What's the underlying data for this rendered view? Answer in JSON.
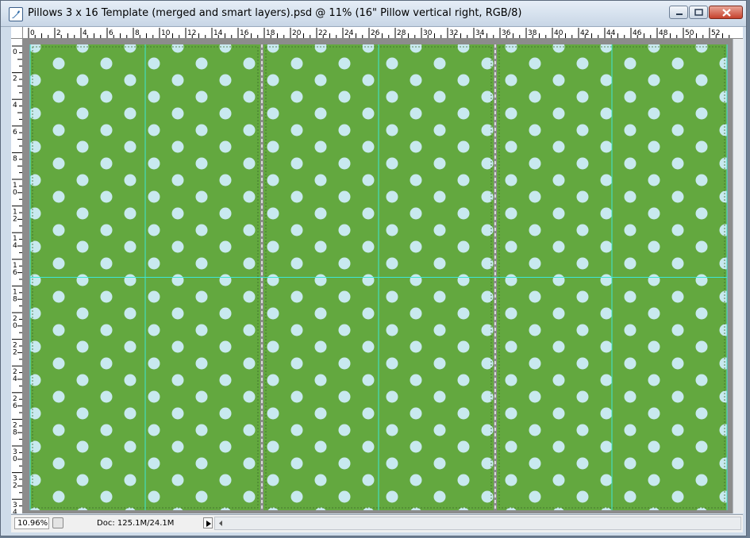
{
  "window": {
    "title": "Pillows 3 x 16 Template (merged and smart layers).psd @ 11% (16\" Pillow vertical right, RGB/8)",
    "app_icon": "photoshop-feather-icon",
    "controls": [
      "minimize-icon",
      "maximize-icon",
      "close-icon"
    ]
  },
  "rulers": {
    "horizontal_labels": [
      "0",
      "2",
      "4",
      "6",
      "8",
      "10",
      "12",
      "14",
      "16",
      "18",
      "20",
      "22",
      "24",
      "26",
      "28",
      "30",
      "32",
      "34",
      "36",
      "38",
      "40",
      "42",
      "44",
      "46",
      "48",
      "50",
      "52"
    ],
    "vertical_labels": [
      "0",
      "2",
      "4",
      "6",
      "8",
      "10",
      "12",
      "14",
      "16",
      "18",
      "20",
      "22",
      "24",
      "26",
      "28",
      "30",
      "32",
      "34"
    ],
    "unit": "inches"
  },
  "document": {
    "panel_count": 3,
    "background_color": "#63a83f",
    "dot_color": "#c8e9ef",
    "guide_color": "#3ee6d6"
  },
  "status_bar": {
    "zoom": "10.96%",
    "doc_info": "Doc: 125.1M/24.1M",
    "icons": [
      "zoom-preview-icon",
      "status-menu-arrow-icon",
      "scroll-left-icon"
    ]
  }
}
